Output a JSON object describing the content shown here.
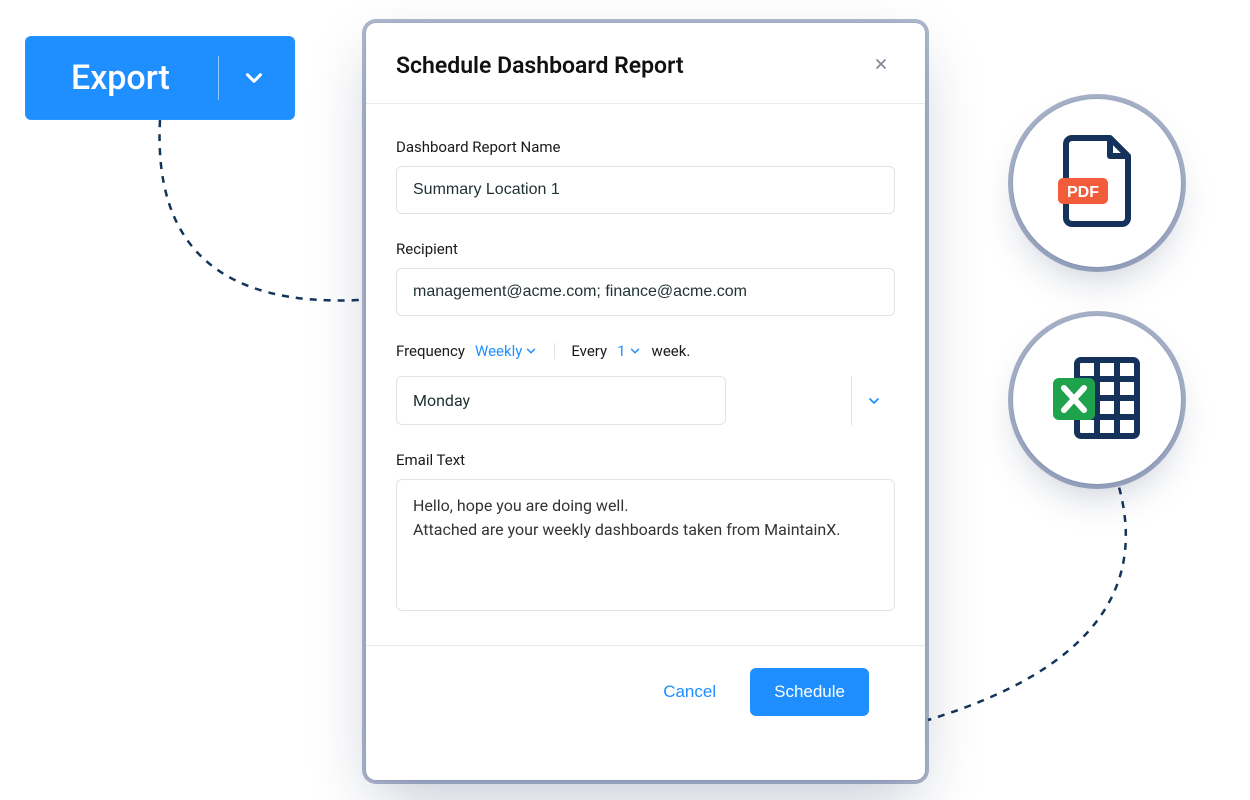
{
  "export_button": {
    "label": "Export"
  },
  "modal": {
    "title": "Schedule Dashboard Report",
    "fields": {
      "report_name": {
        "label": "Dashboard Report Name",
        "value": "Summary Location 1"
      },
      "recipient": {
        "label": "Recipient",
        "value": "management@acme.com; finance@acme.com"
      },
      "frequency": {
        "label": "Frequency",
        "value": "Weekly",
        "every_label": "Every",
        "every_value": "1",
        "every_suffix": "week."
      },
      "day": {
        "value": "Monday"
      },
      "email_text": {
        "label": "Email Text",
        "value": "Hello, hope you are doing well.\nAttached are your weekly dashboards taken from MaintainX."
      }
    },
    "actions": {
      "cancel": "Cancel",
      "schedule": "Schedule"
    }
  },
  "badges": {
    "pdf_label": "PDF"
  }
}
